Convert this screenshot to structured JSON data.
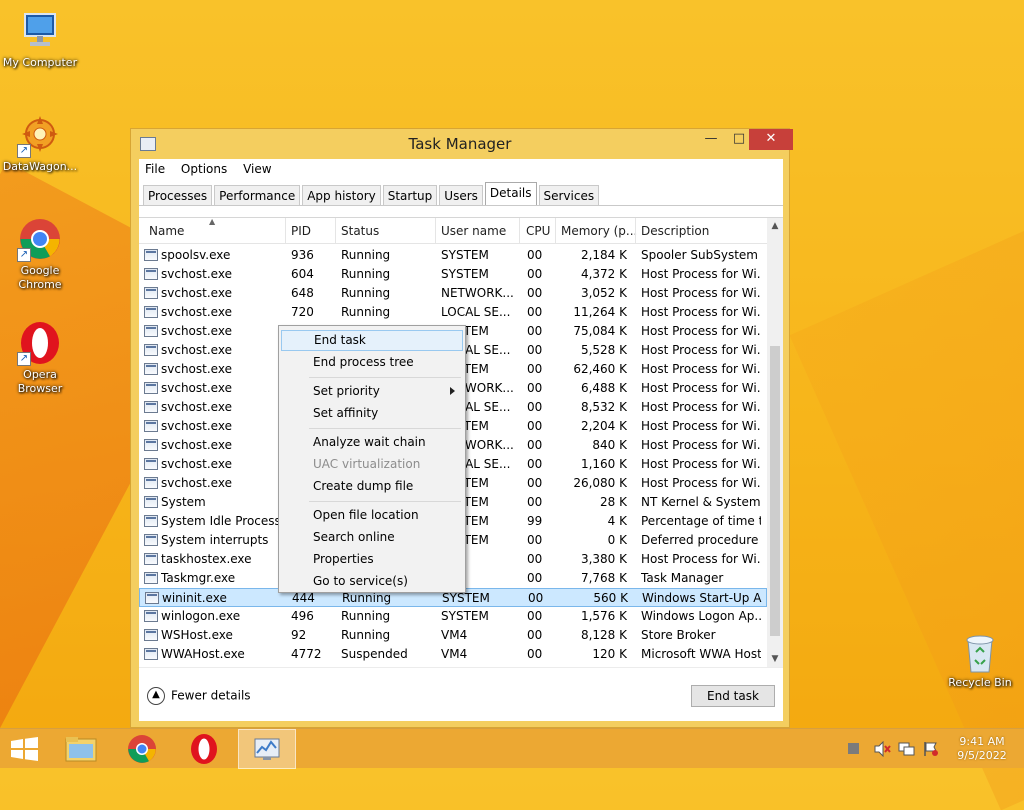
{
  "desktop": {
    "icons": [
      {
        "label": "My Computer"
      },
      {
        "label": "DataWagon..."
      },
      {
        "label": "Google Chrome"
      },
      {
        "label": "Opera Browser"
      }
    ],
    "recycle_bin": "Recycle Bin"
  },
  "window": {
    "title": "Task Manager",
    "controls": {
      "minimize": "—",
      "maximize": "□",
      "close": "✕"
    }
  },
  "menu": {
    "file": "File",
    "options": "Options",
    "view": "View"
  },
  "tabs": [
    {
      "label": "Processes"
    },
    {
      "label": "Performance"
    },
    {
      "label": "App history"
    },
    {
      "label": "Startup"
    },
    {
      "label": "Users"
    },
    {
      "label": "Details",
      "active": true
    },
    {
      "label": "Services"
    }
  ],
  "table": {
    "headers": {
      "name": "Name",
      "pid": "PID",
      "status": "Status",
      "user": "User name",
      "cpu": "CPU",
      "memory": "Memory (p...",
      "description": "Description"
    },
    "rows": [
      {
        "name": "spoolsv.exe",
        "pid": "936",
        "status": "Running",
        "user": "SYSTEM",
        "cpu": "00",
        "memory": "2,184 K",
        "description": "Spooler SubSystem ..."
      },
      {
        "name": "svchost.exe",
        "pid": "604",
        "status": "Running",
        "user": "SYSTEM",
        "cpu": "00",
        "memory": "4,372 K",
        "description": "Host Process for Wi..."
      },
      {
        "name": "svchost.exe",
        "pid": "648",
        "status": "Running",
        "user": "NETWORK...",
        "cpu": "00",
        "memory": "3,052 K",
        "description": "Host Process for Wi..."
      },
      {
        "name": "svchost.exe",
        "pid": "720",
        "status": "Running",
        "user": "LOCAL SE...",
        "cpu": "00",
        "memory": "11,264 K",
        "description": "Host Process for Wi..."
      },
      {
        "name": "svchost.exe",
        "pid": "",
        "status": "",
        "user": "SYSTEM",
        "cpu": "00",
        "memory": "75,084 K",
        "description": "Host Process for Wi..."
      },
      {
        "name": "svchost.exe",
        "pid": "",
        "status": "",
        "user": "LOCAL SE...",
        "cpu": "00",
        "memory": "5,528 K",
        "description": "Host Process for Wi..."
      },
      {
        "name": "svchost.exe",
        "pid": "",
        "status": "",
        "user": "SYSTEM",
        "cpu": "00",
        "memory": "62,460 K",
        "description": "Host Process for Wi..."
      },
      {
        "name": "svchost.exe",
        "pid": "",
        "status": "",
        "user": "NETWORK...",
        "cpu": "00",
        "memory": "6,488 K",
        "description": "Host Process for Wi..."
      },
      {
        "name": "svchost.exe",
        "pid": "",
        "status": "",
        "user": "LOCAL SE...",
        "cpu": "00",
        "memory": "8,532 K",
        "description": "Host Process for Wi..."
      },
      {
        "name": "svchost.exe",
        "pid": "",
        "status": "",
        "user": "SYSTEM",
        "cpu": "00",
        "memory": "2,204 K",
        "description": "Host Process for Wi..."
      },
      {
        "name": "svchost.exe",
        "pid": "",
        "status": "",
        "user": "NETWORK...",
        "cpu": "00",
        "memory": "840 K",
        "description": "Host Process for Wi..."
      },
      {
        "name": "svchost.exe",
        "pid": "",
        "status": "",
        "user": "LOCAL SE...",
        "cpu": "00",
        "memory": "1,160 K",
        "description": "Host Process for Wi..."
      },
      {
        "name": "svchost.exe",
        "pid": "",
        "status": "",
        "user": "SYSTEM",
        "cpu": "00",
        "memory": "26,080 K",
        "description": "Host Process for Wi..."
      },
      {
        "name": "System",
        "pid": "",
        "status": "",
        "user": "SYSTEM",
        "cpu": "00",
        "memory": "28 K",
        "description": "NT Kernel & System"
      },
      {
        "name": "System Idle Process",
        "pid": "",
        "status": "",
        "user": "SYSTEM",
        "cpu": "99",
        "memory": "4 K",
        "description": "Percentage of time t..."
      },
      {
        "name": "System interrupts",
        "pid": "",
        "status": "",
        "user": "SYSTEM",
        "cpu": "00",
        "memory": "0 K",
        "description": "Deferred procedure ..."
      },
      {
        "name": "taskhostex.exe",
        "pid": "",
        "status": "",
        "user": "",
        "cpu": "00",
        "memory": "3,380 K",
        "description": "Host Process for Wi..."
      },
      {
        "name": "Taskmgr.exe",
        "pid": "",
        "status": "",
        "user": "",
        "cpu": "00",
        "memory": "7,768 K",
        "description": "Task Manager"
      },
      {
        "name": "wininit.exe",
        "pid": "444",
        "status": "Running",
        "user": "SYSTEM",
        "cpu": "00",
        "memory": "560 K",
        "description": "Windows Start-Up A...",
        "selected": true
      },
      {
        "name": "winlogon.exe",
        "pid": "496",
        "status": "Running",
        "user": "SYSTEM",
        "cpu": "00",
        "memory": "1,576 K",
        "description": "Windows Logon Ap..."
      },
      {
        "name": "WSHost.exe",
        "pid": "92",
        "status": "Running",
        "user": "VM4",
        "cpu": "00",
        "memory": "8,128 K",
        "description": "Store Broker"
      },
      {
        "name": "WWAHost.exe",
        "pid": "4772",
        "status": "Suspended",
        "user": "VM4",
        "cpu": "00",
        "memory": "120 K",
        "description": "Microsoft WWA Host"
      }
    ]
  },
  "context_menu": {
    "items": [
      {
        "label": "End task",
        "state": "hover"
      },
      {
        "label": "End process tree"
      },
      {
        "separator": true
      },
      {
        "label": "Set priority",
        "submenu": true
      },
      {
        "label": "Set affinity"
      },
      {
        "separator": true
      },
      {
        "label": "Analyze wait chain"
      },
      {
        "label": "UAC virtualization",
        "disabled": true
      },
      {
        "label": "Create dump file"
      },
      {
        "separator": true
      },
      {
        "label": "Open file location"
      },
      {
        "label": "Search online"
      },
      {
        "label": "Properties"
      },
      {
        "label": "Go to service(s)"
      }
    ]
  },
  "footer": {
    "fewer_details": "Fewer details",
    "end_task": "End task"
  },
  "taskbar": {
    "clock_time": "9:41 AM",
    "clock_date": "9/5/2022"
  }
}
